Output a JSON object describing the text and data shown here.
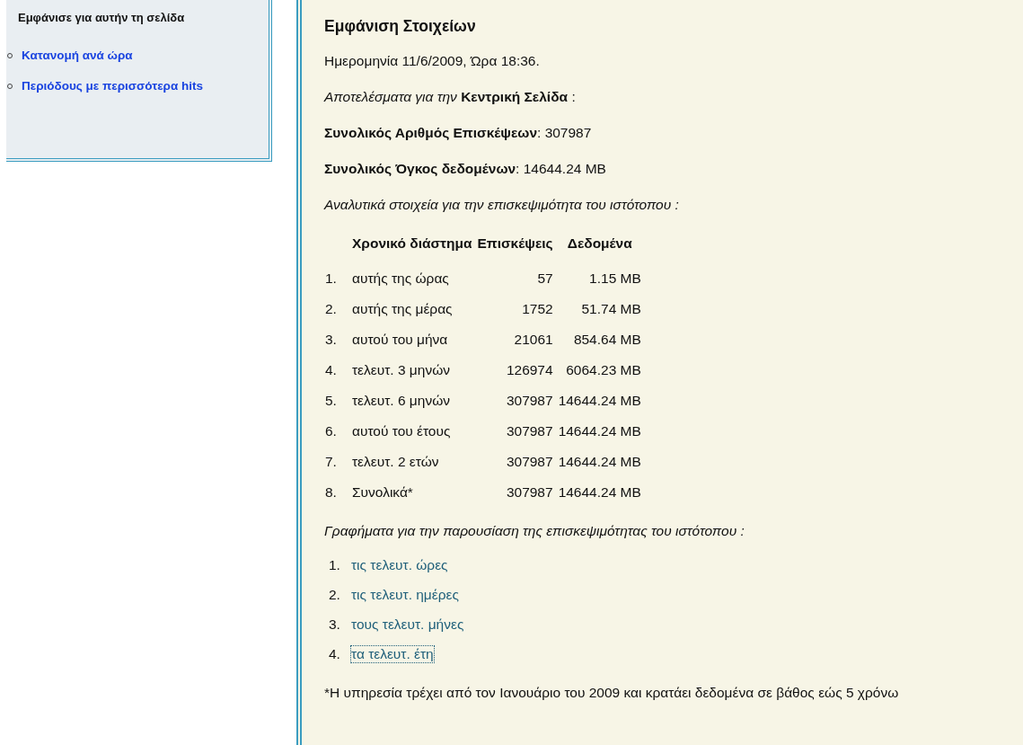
{
  "sidebar": {
    "heading": "Εμφάνισε για αυτήν τη σελίδα",
    "links": [
      {
        "label": "Κατανομή ανά ώρα"
      },
      {
        "label": "Περιόδους με περισσότερα hits"
      }
    ]
  },
  "main": {
    "title": "Εμφάνιση Στοιχείων",
    "paragraphs": [
      {
        "kind": "plain",
        "text": "Ημερομηνία 11/6/2009, Ώρα 18:36."
      },
      {
        "kind": "plain",
        "text": "*Αποτελέσματα για την* **Κεντρική Σελίδα** :"
      },
      {
        "kind": "plain",
        "text": "**Συνολικός Αριθμός Επισκέψεων**: 307987"
      },
      {
        "kind": "plain",
        "text": "**Συνολικός Όγκος δεδομένων**: 14644.24 MB"
      },
      {
        "kind": "italic",
        "text": "Αναλυτικά στοιχεία για την επισκεψιμότητα του ιστότοπου :"
      }
    ],
    "table": {
      "columns": [
        "Χρονικό διάστημα",
        "Επισκέψεις",
        "Δεδομένα"
      ],
      "rows": [
        {
          "number": "1.",
          "period": "αυτής της ώρας",
          "visits": "57",
          "data": "1.15 MB"
        },
        {
          "number": "2.",
          "period": "αυτής της μέρας",
          "visits": "1752",
          "data": "51.74 MB"
        },
        {
          "number": "3.",
          "period": "αυτού του μήνα",
          "visits": "21061",
          "data": "854.64 MB"
        },
        {
          "number": "4.",
          "period": "τελευτ. 3 μηνών",
          "visits": "126974",
          "data": "6064.23 MB"
        },
        {
          "number": "5.",
          "period": "τελευτ. 6 μηνών",
          "visits": "307987",
          "data": "14644.24 MB"
        },
        {
          "number": "6.",
          "period": "αυτού του έτους",
          "visits": "307987",
          "data": "14644.24 MB"
        },
        {
          "number": "7.",
          "period": "τελευτ. 2 ετών",
          "visits": "307987",
          "data": "14644.24 MB"
        },
        {
          "number": "8.",
          "period": "Συνολικά*",
          "visits": "307987",
          "data": "14644.24 MB"
        }
      ]
    },
    "charts_intro": "Γραφήματα για την παρουσίαση της επισκεψιμότητας του ιστότοπου :",
    "chart_links": [
      {
        "number": "1.",
        "label": "τις τελευτ. ώρες",
        "focused": false
      },
      {
        "number": "2.",
        "label": "τις τελευτ. ημέρες",
        "focused": false
      },
      {
        "number": "3.",
        "label": "τους τελευτ. μήνες",
        "focused": false
      },
      {
        "number": "4.",
        "label": "τα τελευτ. έτη",
        "focused": true
      }
    ],
    "footnote": "*Η υπηρεσία τρέχει από τον Ιανουάριο του 2009 και κρατάει δεδομένα σε βάθος εώς 5 χρόνω"
  }
}
